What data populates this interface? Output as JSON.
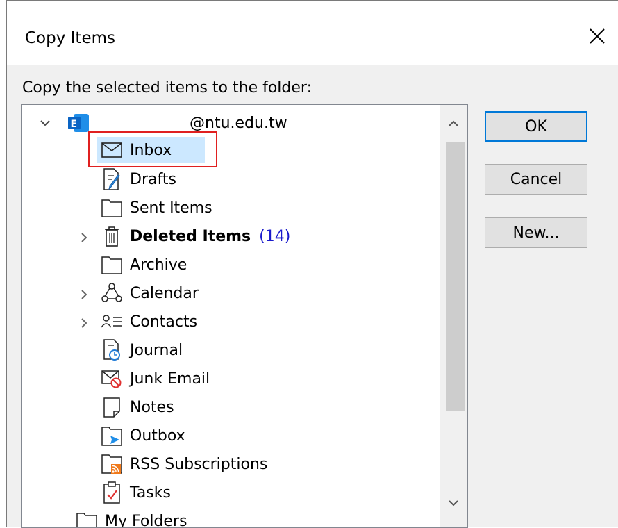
{
  "dialog": {
    "title": "Copy Items"
  },
  "prompt": "Copy the selected items to the folder:",
  "account": {
    "label": "@ntu.edu.tw"
  },
  "folders": [
    {
      "label": "Inbox"
    },
    {
      "label": "Drafts"
    },
    {
      "label": "Sent Items"
    },
    {
      "label": "Deleted Items",
      "count": "(14)"
    },
    {
      "label": "Archive"
    },
    {
      "label": "Calendar"
    },
    {
      "label": "Contacts"
    },
    {
      "label": "Journal"
    },
    {
      "label": "Junk Email"
    },
    {
      "label": "Notes"
    },
    {
      "label": "Outbox"
    },
    {
      "label": "RSS Subscriptions"
    },
    {
      "label": "Tasks"
    }
  ],
  "partial_row": {
    "label": "My Folders"
  },
  "buttons": {
    "ok": "OK",
    "cancel": "Cancel",
    "new": "New..."
  },
  "colors": {
    "selection": "#cce8ff",
    "highlight_border": "#e02020",
    "count": "#1a1acc",
    "ok_border": "#0078d7"
  }
}
